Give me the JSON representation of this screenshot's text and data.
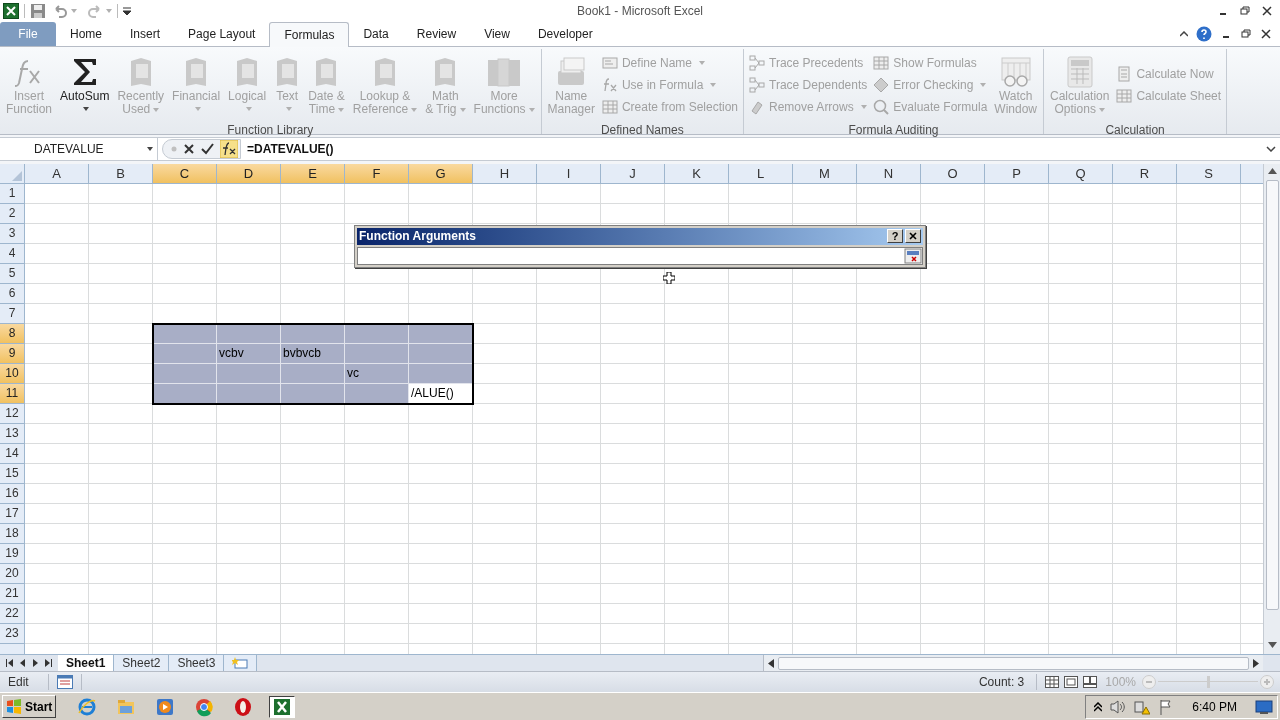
{
  "window": {
    "title": "Book1 - Microsoft Excel"
  },
  "tabs": [
    {
      "label": "File",
      "kind": "file",
      "selected": false
    },
    {
      "label": "Home",
      "kind": "tab",
      "selected": false
    },
    {
      "label": "Insert",
      "kind": "tab",
      "selected": false
    },
    {
      "label": "Page Layout",
      "kind": "tab",
      "selected": false
    },
    {
      "label": "Formulas",
      "kind": "tab",
      "selected": true
    },
    {
      "label": "Data",
      "kind": "tab",
      "selected": false
    },
    {
      "label": "Review",
      "kind": "tab",
      "selected": false
    },
    {
      "label": "View",
      "kind": "tab",
      "selected": false
    },
    {
      "label": "Developer",
      "kind": "tab",
      "selected": false
    }
  ],
  "ribbon_groups": [
    {
      "name": "Function Library",
      "items": [
        {
          "kind": "large",
          "label": "Insert\nFunction",
          "dropdown": false,
          "disabled": true
        },
        {
          "kind": "large",
          "label": "AutoSum",
          "dropdown": true,
          "disabled": false
        },
        {
          "kind": "large",
          "label": "Recently\nUsed",
          "dropdown": true,
          "disabled": true
        },
        {
          "kind": "large",
          "label": "Financial",
          "dropdown": true,
          "disabled": true
        },
        {
          "kind": "large",
          "label": "Logical",
          "dropdown": true,
          "disabled": true
        },
        {
          "kind": "large",
          "label": "Text",
          "dropdown": true,
          "disabled": true
        },
        {
          "kind": "large",
          "label": "Date &\nTime",
          "dropdown": true,
          "disabled": true
        },
        {
          "kind": "large",
          "label": "Lookup &\nReference",
          "dropdown": true,
          "disabled": true
        },
        {
          "kind": "large",
          "label": "Math\n& Trig",
          "dropdown": true,
          "disabled": true
        },
        {
          "kind": "large",
          "label": "More\nFunctions",
          "dropdown": true,
          "disabled": true
        }
      ]
    },
    {
      "name": "Defined Names",
      "items": [
        {
          "kind": "large",
          "label": "Name\nManager",
          "dropdown": false,
          "disabled": true
        },
        {
          "kind": "small",
          "label": "Define Name",
          "dropdown": true,
          "disabled": true
        },
        {
          "kind": "small",
          "label": "Use in Formula",
          "dropdown": true,
          "disabled": true
        },
        {
          "kind": "small",
          "label": "Create from Selection",
          "dropdown": false,
          "disabled": true
        }
      ]
    },
    {
      "name": "Formula Auditing",
      "items": [
        {
          "kind": "small",
          "label": "Trace Precedents",
          "dropdown": false,
          "disabled": true
        },
        {
          "kind": "small",
          "label": "Trace Dependents",
          "dropdown": false,
          "disabled": true
        },
        {
          "kind": "small",
          "label": "Remove Arrows",
          "dropdown": true,
          "disabled": true
        },
        {
          "kind": "small",
          "label": "Show Formulas",
          "dropdown": false,
          "disabled": true
        },
        {
          "kind": "small",
          "label": "Error Checking",
          "dropdown": true,
          "disabled": true
        },
        {
          "kind": "small",
          "label": "Evaluate Formula",
          "dropdown": false,
          "disabled": true
        },
        {
          "kind": "large",
          "label": "Watch\nWindow",
          "dropdown": false,
          "disabled": true
        }
      ]
    },
    {
      "name": "Calculation",
      "items": [
        {
          "kind": "large",
          "label": "Calculation\nOptions",
          "dropdown": true,
          "disabled": true
        },
        {
          "kind": "small",
          "label": "Calculate Now",
          "dropdown": false,
          "disabled": true
        },
        {
          "kind": "small",
          "label": "Calculate Sheet",
          "dropdown": false,
          "disabled": true
        }
      ]
    }
  ],
  "name_box": {
    "value": "DATEVALUE"
  },
  "formula_bar": {
    "value": "=DATEVALUE()"
  },
  "columns": [
    {
      "label": "A",
      "selected": false
    },
    {
      "label": "B",
      "selected": false
    },
    {
      "label": "C",
      "selected": true
    },
    {
      "label": "D",
      "selected": true
    },
    {
      "label": "E",
      "selected": true
    },
    {
      "label": "F",
      "selected": true
    },
    {
      "label": "G",
      "selected": true
    },
    {
      "label": "H",
      "selected": false
    },
    {
      "label": "I",
      "selected": false
    },
    {
      "label": "J",
      "selected": false
    },
    {
      "label": "K",
      "selected": false
    },
    {
      "label": "L",
      "selected": false
    },
    {
      "label": "M",
      "selected": false
    },
    {
      "label": "N",
      "selected": false
    },
    {
      "label": "O",
      "selected": false
    },
    {
      "label": "P",
      "selected": false
    },
    {
      "label": "Q",
      "selected": false
    },
    {
      "label": "R",
      "selected": false
    },
    {
      "label": "S",
      "selected": false
    }
  ],
  "rows": [
    {
      "label": "1",
      "selected": false
    },
    {
      "label": "2",
      "selected": false
    },
    {
      "label": "3",
      "selected": false
    },
    {
      "label": "4",
      "selected": false
    },
    {
      "label": "5",
      "selected": false
    },
    {
      "label": "6",
      "selected": false
    },
    {
      "label": "7",
      "selected": false
    },
    {
      "label": "8",
      "selected": true
    },
    {
      "label": "9",
      "selected": true,
      "cells": [
        {},
        {},
        {},
        {
          "text": "vcbv"
        },
        {
          "text": "bvbvcb"
        }
      ]
    },
    {
      "label": "10",
      "selected": true,
      "cells": [
        {},
        {},
        {},
        {},
        {},
        {
          "text": "vc"
        }
      ]
    },
    {
      "label": "11",
      "selected": true,
      "cells": [
        {},
        {},
        {},
        {},
        {},
        {},
        {
          "text": "/ALUE()",
          "editing": true
        }
      ]
    },
    {
      "label": "12",
      "selected": false
    },
    {
      "label": "13",
      "selected": false
    },
    {
      "label": "14",
      "selected": false
    },
    {
      "label": "15",
      "selected": false
    },
    {
      "label": "16",
      "selected": false
    },
    {
      "label": "17",
      "selected": false
    },
    {
      "label": "18",
      "selected": false
    },
    {
      "label": "19",
      "selected": false
    },
    {
      "label": "20",
      "selected": false
    },
    {
      "label": "21",
      "selected": false
    },
    {
      "label": "22",
      "selected": false
    },
    {
      "label": "23",
      "selected": false
    }
  ],
  "dialog": {
    "title": "Function Arguments",
    "help": "?"
  },
  "sheet_tabs": [
    {
      "label": "Sheet1",
      "selected": true
    },
    {
      "label": "Sheet2",
      "selected": false
    },
    {
      "label": "Sheet3",
      "selected": false
    }
  ],
  "status_bar": {
    "mode": "Edit",
    "count": "Count: 3",
    "zoom": "100%",
    "zoom_slider": {
      "level": 0.5
    }
  },
  "taskbar": {
    "start": "Start",
    "apps": [
      {
        "kind": "ie",
        "selected": false
      },
      {
        "kind": "folder",
        "selected": false
      },
      {
        "kind": "media",
        "selected": false
      },
      {
        "kind": "chrome",
        "selected": false
      },
      {
        "kind": "opera",
        "selected": false
      },
      {
        "kind": "excel",
        "selected": true
      }
    ],
    "clock": "6:40 PM"
  }
}
